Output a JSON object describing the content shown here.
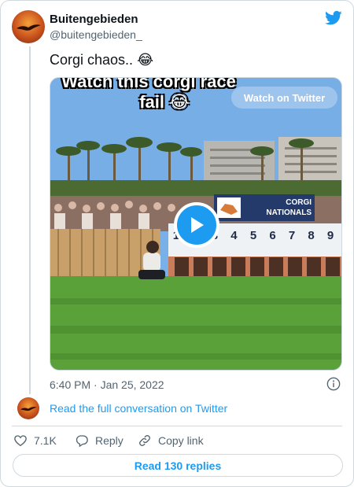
{
  "author": {
    "display_name": "Buitengebieden",
    "handle": "@buitengebieden_",
    "avatar_icon": "bird-silhouette-sunset-avatar"
  },
  "brand": {
    "logo_icon": "twitter-bird-icon",
    "color": "#1d9bf0"
  },
  "tweet": {
    "text": "Corgi chaos..",
    "emoji": "😂"
  },
  "media": {
    "overlay_caption_line1": "Watch this corgi race",
    "overlay_caption_line2": "fail 😂",
    "watch_button_label": "Watch on Twitter",
    "play_icon": "play-icon",
    "sign_text_line1": "CORGI",
    "sign_text_line2": "NATIONALS",
    "gate_numbers": "1 2 3 4 5 6 7 8 9"
  },
  "meta": {
    "timestamp": "6:40 PM · Jan 25, 2022",
    "info_icon": "info-icon"
  },
  "conversation": {
    "link_label": "Read the full conversation on Twitter"
  },
  "actions": {
    "like_count": "7.1K",
    "reply_label": "Reply",
    "copy_link_label": "Copy link"
  },
  "replies": {
    "button_label": "Read 130 replies"
  },
  "colors": {
    "accent": "#1d9bf0",
    "secondary_text": "#536471",
    "border": "#cfd9de"
  }
}
